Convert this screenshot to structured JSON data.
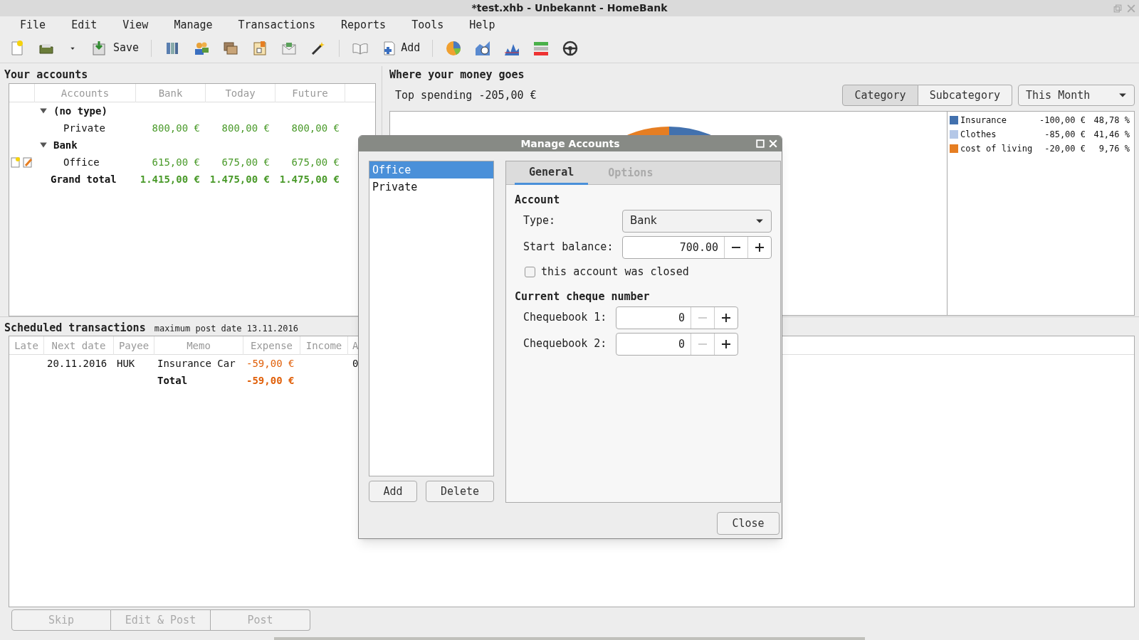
{
  "window": {
    "title": "*test.xhb - Unbekannt - HomeBank"
  },
  "menu": [
    "File",
    "Edit",
    "View",
    "Manage",
    "Transactions",
    "Reports",
    "Tools",
    "Help"
  ],
  "toolbar": {
    "save_label": "Save",
    "add_label": "Add"
  },
  "accounts": {
    "title": "Your accounts",
    "columns": [
      "Accounts",
      "Bank",
      "Today",
      "Future"
    ],
    "groups": [
      {
        "name": "(no type)",
        "expanded": true,
        "children": [
          {
            "name": "Private",
            "bank": "800,00 €",
            "today": "800,00 €",
            "future": "800,00 €",
            "status_icons": false
          }
        ]
      },
      {
        "name": "Bank",
        "expanded": true,
        "children": [
          {
            "name": "Office",
            "bank": "615,00 €",
            "today": "675,00 €",
            "future": "675,00 €",
            "status_icons": true
          }
        ]
      }
    ],
    "total": {
      "label": "Grand total",
      "bank": "1.415,00 €",
      "today": "1.475,00 €",
      "future": "1.475,00 €"
    }
  },
  "spending": {
    "title": "Where your money goes",
    "top": "Top spending -205,00 €",
    "modes": [
      {
        "label": "Category",
        "selected": true
      },
      {
        "label": "Subcategory",
        "selected": false
      }
    ],
    "period": "This Month",
    "legend": [
      {
        "name": "Insurance",
        "amount": "-100,00 €",
        "percent": "48,78 %",
        "color": "#4271ae"
      },
      {
        "name": "Clothes",
        "amount": "-85,00 €",
        "percent": "41,46 %",
        "color": "#b4c7e7"
      },
      {
        "name": "cost of living",
        "amount": "-20,00 €",
        "percent": "9,76 %",
        "color": "#e67e22"
      }
    ]
  },
  "scheduled": {
    "title": "Scheduled transactions",
    "subtitle": "maximum post date 13.11.2016",
    "columns": [
      "Late",
      "Next date",
      "Payee",
      "Memo",
      "Expense",
      "Income",
      "A"
    ],
    "rows": [
      {
        "late": "",
        "next_date": "20.11.2016",
        "payee": "HUK",
        "memo": "Insurance Car",
        "expense": "-59,00 €",
        "income": "",
        "column_7": "0"
      }
    ],
    "total": {
      "label": "Total",
      "expense": "-59,00 €"
    },
    "buttons": [
      {
        "label": "Skip",
        "disabled": true
      },
      {
        "label": "Edit & Post",
        "disabled": true
      },
      {
        "label": "Post",
        "disabled": true
      }
    ]
  },
  "dialog": {
    "title": "Manage Accounts",
    "accounts": [
      {
        "name": "Office",
        "selected": true
      },
      {
        "name": "Private",
        "selected": false
      }
    ],
    "list_buttons": [
      "Add",
      "Delete"
    ],
    "tabs": [
      {
        "label": "General",
        "selected": true
      },
      {
        "label": "Options",
        "selected": false
      }
    ],
    "section_account": "Account",
    "type_label": "Type:",
    "type_value": "Bank",
    "balance_label": "Start balance:",
    "balance_value": "700.00",
    "closed": {
      "label": "this account was closed",
      "checked": false
    },
    "section_cheque": "Current cheque number",
    "chequebooks": [
      {
        "label": "Chequebook 1:",
        "value": "0",
        "minus_disabled": true
      },
      {
        "label": "Chequebook 2:",
        "value": "0",
        "minus_disabled": true
      }
    ],
    "close_label": "Close"
  }
}
